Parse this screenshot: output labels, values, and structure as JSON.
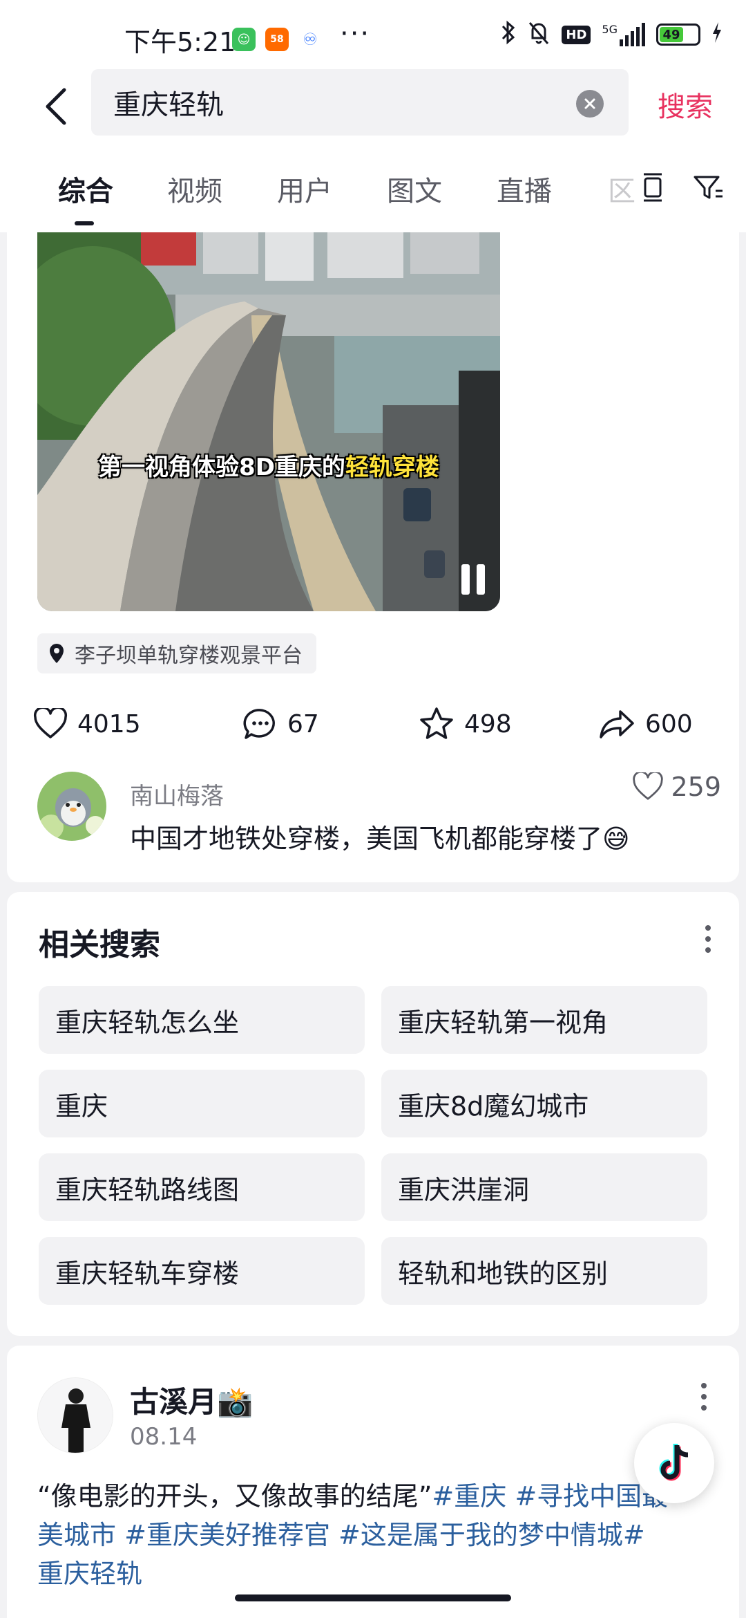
{
  "status_bar": {
    "time": "下午5:21",
    "network": "5G",
    "battery": "49",
    "hd": "HD",
    "more": "···"
  },
  "search": {
    "query": "重庆轻轨",
    "button_label": "搜索"
  },
  "tabs": [
    {
      "label": "综合",
      "active": true
    },
    {
      "label": "视频"
    },
    {
      "label": "用户"
    },
    {
      "label": "图文"
    },
    {
      "label": "直播"
    },
    {
      "label": "区"
    }
  ],
  "video_post": {
    "caption_prefix": "第一视角体验8D重庆的",
    "caption_highlight": "轻轨穿楼",
    "location": "李子坝单轨穿楼观景平台",
    "likes": "4015",
    "comments": "67",
    "favorites": "498",
    "shares": "600",
    "top_comment": {
      "author": "南山梅落",
      "text": "中国才地铁处穿楼，美国飞机都能穿楼了",
      "emoji": "😅",
      "likes": "259"
    }
  },
  "related": {
    "title": "相关搜索",
    "items": [
      "重庆轻轨怎么坐",
      "重庆轻轨第一视角",
      "重庆",
      "重庆8d魔幻城市",
      "重庆轻轨路线图",
      "重庆洪崖洞",
      "重庆轻轨车穿楼",
      "轻轨和地铁的区别"
    ]
  },
  "next_post": {
    "author": "古溪月",
    "author_emoji": "📸",
    "date": "08.14",
    "text_plain": "“像电影的开头，又像故事的结尾”",
    "tag1": "#重庆",
    "tag2": "#寻找中国最",
    "tag2b": "美城市",
    "tag3": "#重庆美好推荐官",
    "tag4": "#这是属于我的梦中情城#",
    "tag4b": "重庆轻轨"
  },
  "colors": {
    "accent": "#e8315f",
    "hashtag": "#2b5f9e",
    "text": "#161823",
    "bg": "#f2f2f4"
  }
}
